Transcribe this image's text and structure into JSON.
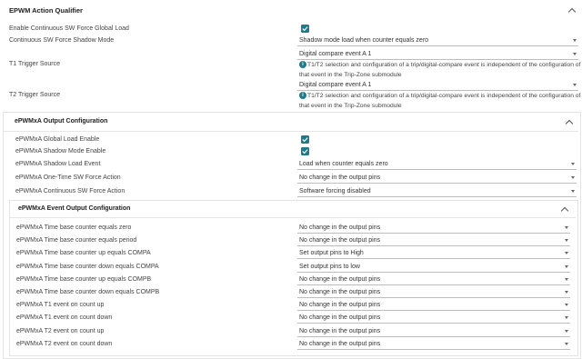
{
  "top_section": {
    "title": "EPWM Action Qualifier",
    "fields": {
      "global_load_label": "Enable Continuous SW Force Global Load",
      "shadow_mode_label": "Continuous SW Force Shadow Mode",
      "shadow_mode_value": "Shadow mode load when counter equals zero",
      "t1_label": "T1 Trigger Source",
      "t1_value": "Digital compare event A 1",
      "t1_info": "T1/T2 selection and configuration of a trip/digital-compare event is independent of the configuration of that event in the Trip-Zone submodule",
      "t2_label": "T2 Trigger Source",
      "t2_value": "Digital compare event A 1",
      "t2_info": "T1/T2 selection and configuration of a trip/digital-compare event is independent of the configuration of that event in the Trip-Zone submodule"
    }
  },
  "output_config": {
    "title": "ePWMxA Output Configuration",
    "fields": {
      "global_load_label": "ePWMxA Global Load Enable",
      "shadow_mode_label": "ePWMxA Shadow Mode Enable",
      "shadow_load_label": "ePWMxA Shadow Load Event",
      "shadow_load_value": "Load when counter equals zero",
      "onetime_label": "ePWMxA One-Time SW Force Action",
      "onetime_value": "No change in the output pins",
      "continuous_label": "ePWMxA Continuous SW Force Action",
      "continuous_value": "Software forcing disabled"
    }
  },
  "event_config": {
    "title": "ePWMxA Event Output Configuration",
    "rows": [
      {
        "label": "ePWMxA Time base counter equals zero",
        "value": "No change in the output pins"
      },
      {
        "label": "ePWMxA Time base counter equals period",
        "value": "No change in the output pins"
      },
      {
        "label": "ePWMxA Time base counter up equals COMPA",
        "value": "Set output pins to High"
      },
      {
        "label": "ePWMxA Time base counter down equals COMPA",
        "value": "Set output pins to low"
      },
      {
        "label": "ePWMxA Time base counter up equals COMPB",
        "value": "No change in the output pins"
      },
      {
        "label": "ePWMxA Time base counter down equals COMPB",
        "value": "No change in the output pins"
      },
      {
        "label": "ePWMxA T1 event on count up",
        "value": "No change in the output pins"
      },
      {
        "label": "ePWMxA T1 event on count down",
        "value": "No change in the output pins"
      },
      {
        "label": "ePWMxA T2 event on count up",
        "value": "No change in the output pins"
      },
      {
        "label": "ePWMxA T2 event on count down",
        "value": "No change in the output pins"
      }
    ]
  },
  "icons": {
    "info": "info-icon",
    "checkbox": "checkbox-checked-icon",
    "collapse": "chevron-up-icon",
    "dropdown": "caret-down-icon"
  },
  "colors": {
    "accent": "#1d7b8a"
  }
}
